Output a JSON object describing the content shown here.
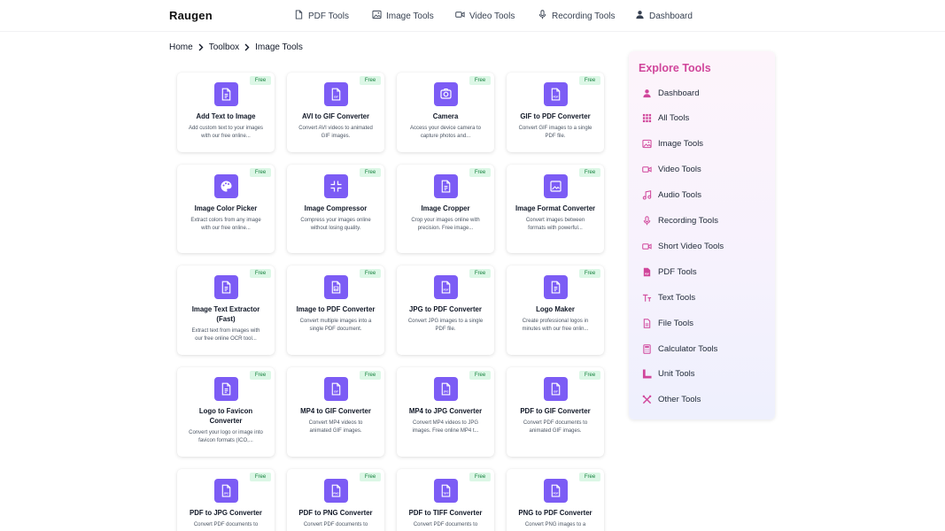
{
  "brand": "Raugen",
  "nav": [
    {
      "label": "PDF Tools",
      "icon": "pdf-file-icon"
    },
    {
      "label": "Image Tools",
      "icon": "image-icon"
    },
    {
      "label": "Video Tools",
      "icon": "video-icon"
    },
    {
      "label": "Recording Tools",
      "icon": "microphone-icon"
    },
    {
      "label": "Dashboard",
      "icon": "user-icon"
    }
  ],
  "breadcrumb": [
    "Home",
    "Toolbox",
    "Image Tools"
  ],
  "badge_label": "Free",
  "cards": [
    {
      "title": "Add Text to Image",
      "desc": "Add custom text to your images with our free online...",
      "icon": "text-doc-icon"
    },
    {
      "title": "AVI to GIF Converter",
      "desc": "Convert AVI videos to animated GIF images.",
      "icon": "gif-file-icon"
    },
    {
      "title": "Camera",
      "desc": "Access your device camera to capture photos and...",
      "icon": "camera-icon"
    },
    {
      "title": "GIF to PDF Converter",
      "desc": "Convert GIF images to a single PDF file.",
      "icon": "pdf-file-icon"
    },
    {
      "title": "Image Color Picker",
      "desc": "Extract colors from any image with our free online...",
      "icon": "palette-icon"
    },
    {
      "title": "Image Compressor",
      "desc": "Compress your images online without losing quality.",
      "icon": "compress-icon"
    },
    {
      "title": "Image Cropper",
      "desc": "Crop your images online with precision. Free image...",
      "icon": "text-doc-icon"
    },
    {
      "title": "Image Format Converter",
      "desc": "Convert images between formats with powerful...",
      "icon": "image-frame-icon"
    },
    {
      "title": "Image Text Extractor (Fast)",
      "desc": "Extract text from images with our free online OCR tool...",
      "icon": "text-doc-icon"
    },
    {
      "title": "Image to PDF Converter",
      "desc": "Convert multiple images into a single PDF document.",
      "icon": "image-doc-icon"
    },
    {
      "title": "JPG to PDF Converter",
      "desc": "Convert JPG images to a single PDF file.",
      "icon": "pdf-file-icon"
    },
    {
      "title": "Logo Maker",
      "desc": "Create professional logos in minutes with our free onlin...",
      "icon": "text-doc-icon"
    },
    {
      "title": "Logo to Favicon Converter",
      "desc": "Convert your logo or image into favicon formats (ICO,...",
      "icon": "text-doc-icon"
    },
    {
      "title": "MP4 to GIF Converter",
      "desc": "Convert MP4 videos to animated GIF images.",
      "icon": "gif-file-icon"
    },
    {
      "title": "MP4 to JPG Converter",
      "desc": "Convert MP4 videos to JPG images. Free online MP4 t...",
      "icon": "jpg-file-icon"
    },
    {
      "title": "PDF to GIF Converter",
      "desc": "Convert PDF documents to animated GIF images.",
      "icon": "gif-file-icon"
    },
    {
      "title": "PDF to JPG Converter",
      "desc": "Convert PDF documents to",
      "icon": "jpg-file-icon"
    },
    {
      "title": "PDF to PNG Converter",
      "desc": "Convert PDF documents to",
      "icon": "png-file-icon"
    },
    {
      "title": "PDF to TIFF Converter",
      "desc": "Convert PDF documents to",
      "icon": "tiff-file-icon"
    },
    {
      "title": "PNG to PDF Converter",
      "desc": "Convert PNG images to a",
      "icon": "pdf-file-icon"
    }
  ],
  "explore": {
    "title": "Explore Tools",
    "items": [
      {
        "label": "Dashboard",
        "icon": "user-icon"
      },
      {
        "label": "All Tools",
        "icon": "grid-icon"
      },
      {
        "label": "Image Tools",
        "icon": "image-icon"
      },
      {
        "label": "Video Tools",
        "icon": "video-icon"
      },
      {
        "label": "Audio Tools",
        "icon": "music-note-icon"
      },
      {
        "label": "Recording Tools",
        "icon": "microphone-icon"
      },
      {
        "label": "Short Video Tools",
        "icon": "video-icon"
      },
      {
        "label": "PDF Tools",
        "icon": "pdf-file-icon"
      },
      {
        "label": "Text Tools",
        "icon": "text-size-icon"
      },
      {
        "label": "File Tools",
        "icon": "file-icon"
      },
      {
        "label": "Calculator Tools",
        "icon": "calculator-icon"
      },
      {
        "label": "Unit Tools",
        "icon": "ruler-icon"
      },
      {
        "label": "Other Tools",
        "icon": "tools-icon"
      }
    ]
  },
  "colors": {
    "accent_purple": "#7c5cf5",
    "explore_title_pink": "#d0469b",
    "explore_icon_pink": "#d0469b",
    "badge_bg": "#dcf7e6",
    "badge_text": "#15803d"
  }
}
